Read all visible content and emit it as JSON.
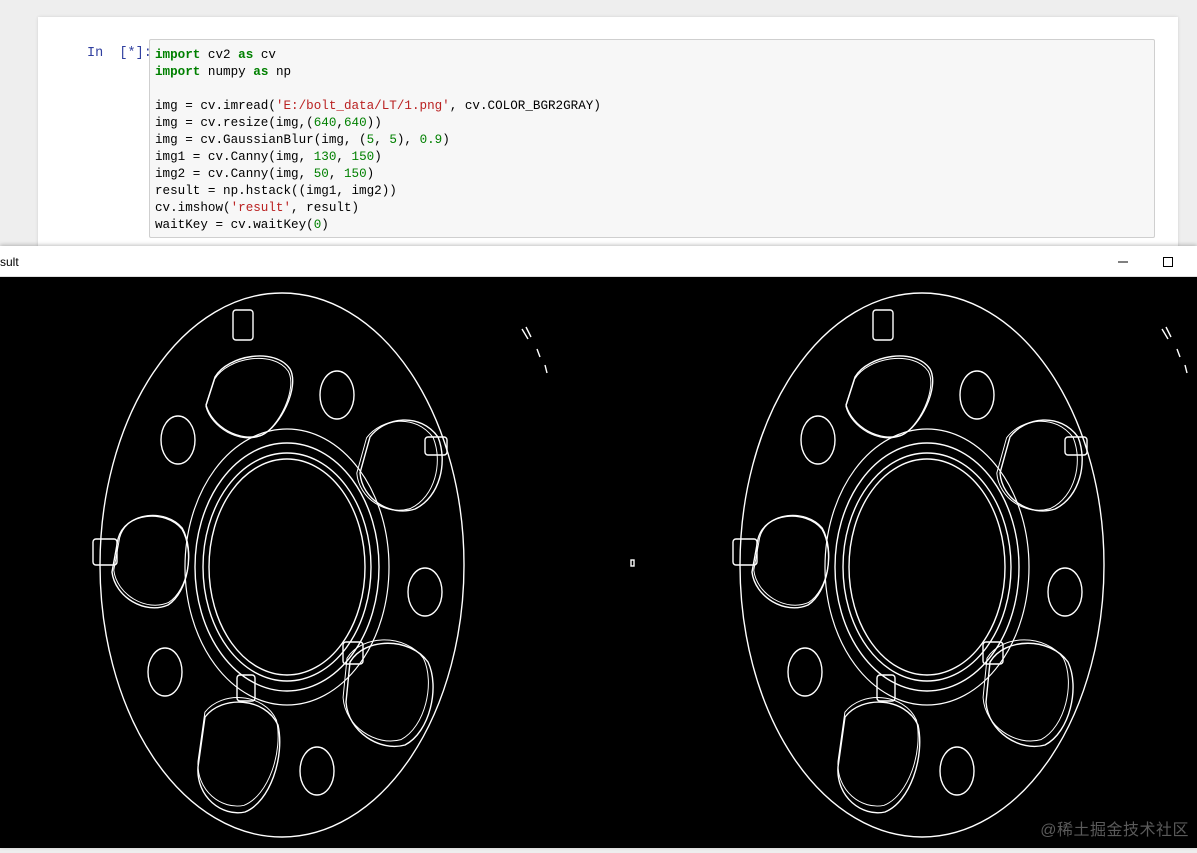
{
  "notebook": {
    "prompt": "In  [*]:",
    "code_lines": [
      [
        {
          "t": "import",
          "c": "kw"
        },
        {
          "t": " cv2 "
        },
        {
          "t": "as",
          "c": "kw"
        },
        {
          "t": " cv"
        }
      ],
      [
        {
          "t": "import",
          "c": "kw"
        },
        {
          "t": " numpy "
        },
        {
          "t": "as",
          "c": "kw"
        },
        {
          "t": " np"
        }
      ],
      [],
      [
        {
          "t": "img = cv.imread("
        },
        {
          "t": "'E:/bolt_data/LT/1.png'",
          "c": "str"
        },
        {
          "t": ", cv.COLOR_BGR2GRAY)"
        }
      ],
      [
        {
          "t": "img = cv.resize(img,("
        },
        {
          "t": "640",
          "c": "num"
        },
        {
          "t": ","
        },
        {
          "t": "640",
          "c": "num"
        },
        {
          "t": "))"
        }
      ],
      [
        {
          "t": "img = cv.GaussianBlur(img, ("
        },
        {
          "t": "5",
          "c": "num"
        },
        {
          "t": ", "
        },
        {
          "t": "5",
          "c": "num"
        },
        {
          "t": "), "
        },
        {
          "t": "0.9",
          "c": "num"
        },
        {
          "t": ")"
        }
      ],
      [
        {
          "t": "img1 = cv.Canny(img, "
        },
        {
          "t": "130",
          "c": "num"
        },
        {
          "t": ", "
        },
        {
          "t": "150",
          "c": "num"
        },
        {
          "t": ")"
        }
      ],
      [
        {
          "t": "img2 = cv.Canny(img, "
        },
        {
          "t": "50",
          "c": "num"
        },
        {
          "t": ", "
        },
        {
          "t": "150",
          "c": "num"
        },
        {
          "t": ")"
        }
      ],
      [
        {
          "t": "result = np.hstack((img1, img2))"
        }
      ],
      [
        {
          "t": "cv.imshow("
        },
        {
          "t": "'result'",
          "c": "str"
        },
        {
          "t": ", result)"
        }
      ],
      [
        {
          "t": "waitKey = cv.waitKey("
        },
        {
          "t": "0",
          "c": "num"
        },
        {
          "t": ")"
        }
      ]
    ]
  },
  "window": {
    "title": "sult"
  },
  "watermark": "@稀土掘金技术社区",
  "colors": {
    "edge": "#ffffff",
    "background": "#000000",
    "prompt": "#303f9f"
  }
}
